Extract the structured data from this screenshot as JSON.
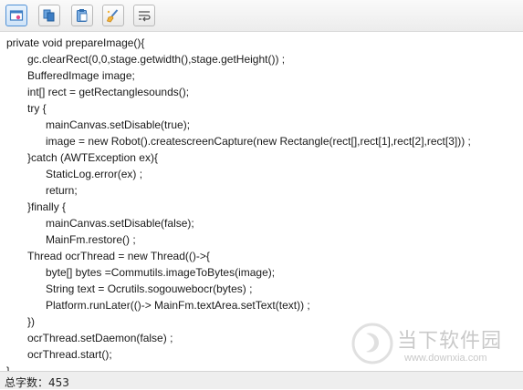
{
  "toolbar": {
    "buttons": [
      {
        "icon": "screenshot-ocr-icon"
      },
      {
        "icon": "copy-icon"
      },
      {
        "icon": "paste-icon"
      },
      {
        "icon": "clear-brush-icon"
      },
      {
        "icon": "word-wrap-icon"
      }
    ]
  },
  "editor": {
    "lines": [
      "private void prepareImage(){",
      "gc.clearRect(0,0,stage.getwidth(),stage.getHeight()) ;",
      "BufferedImage image;",
      "int[] rect = getRectanglesounds();",
      "try {",
      "mainCanvas.setDisable(true);",
      "image = new Robot().createscreenCapture(new Rectangle(rect[],rect[1],rect[2],rect[3])) ;",
      "}catch (AWTException ex){",
      "StaticLog.error(ex) ;",
      "return;",
      "}finally {",
      "mainCanvas.setDisable(false);",
      "MainFm.restore() ;",
      "Thread ocrThread = new Thread(()->{",
      "byte[] bytes =Commutils.imageToBytes(image);",
      "String text = Ocrutils.sogouwebocr(bytes) ;",
      "Platform.runLater(()-> MainFm.textArea.setText(text)) ;",
      "})",
      "ocrThread.setDaemon(false) ;",
      "ocrThread.start();",
      "}"
    ]
  },
  "watermark": {
    "name": "当下软件园",
    "url": "www.downxia.com"
  },
  "status": {
    "word_count": "总字数：453"
  },
  "colors": {
    "accent": "#4f90d6",
    "text": "#1a1a1a",
    "watermark": "#c9c9c9"
  }
}
